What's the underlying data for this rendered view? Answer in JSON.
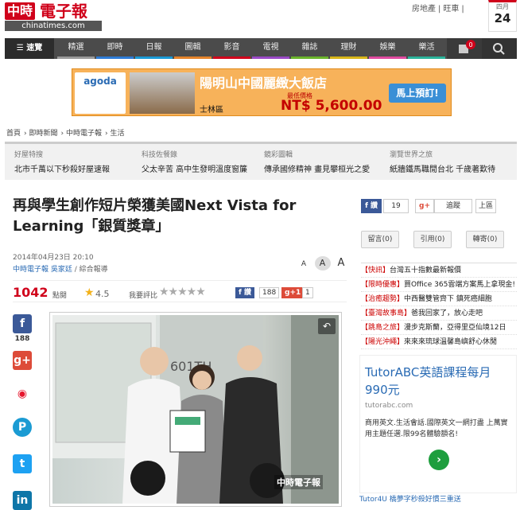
{
  "site": {
    "logo_zh": "中時",
    "logo_zh2": "電子報",
    "logo_en": "chinatimes.com",
    "links": [
      "房地產",
      "旺車"
    ],
    "date_month": "四月",
    "date_day": "24"
  },
  "nav": {
    "search_btn": "速覽",
    "items": [
      "精選",
      "即時",
      "日報",
      "圖輯",
      "影音",
      "電視",
      "雜誌",
      "理財",
      "娛樂",
      "樂活"
    ],
    "colors": [
      "#9a9a9a",
      "#2e7bd6",
      "#1a9ad6",
      "#e4832a",
      "#d0021b",
      "#9a49c6",
      "#6ab42a",
      "#d8b618",
      "#e04aa0",
      "#2ab39a"
    ],
    "bag_count": "0"
  },
  "ad": {
    "brand": "agoda",
    "hotel": "陽明山中國麗緻大飯店",
    "location": "士林區",
    "price_label": "最低價格",
    "price": "NT$ 5,600.00",
    "button": "馬上預訂!"
  },
  "breadcrumb": [
    "首頁",
    "即時新聞",
    "中時電子報",
    "生活"
  ],
  "strip": [
    {
      "head": "好屋特搜",
      "body": "北市千萬以下秒殺好屋速報"
    },
    {
      "head": "科技佐餐錄",
      "body": "父太辛苦 高中生發明溫度窗簾"
    },
    {
      "head": "鏡彩圖輯",
      "body": "傳承國修精神 畫見攀桓光之愛"
    },
    {
      "head": "瀏覽世界之旅",
      "body": "紙牆鐵馬職閒台北 千歲著歎待"
    }
  ],
  "article": {
    "title": "再與學生創作短片榮獲美國Next Vista for Learning「銀質獎章」",
    "datetime": "2014年04月23日 20:10",
    "source": "中時電子報",
    "author": "吳家廷",
    "source_suffix": "/ 綜合報導",
    "font_sizes": [
      "A",
      "A",
      "A"
    ],
    "views": "1042",
    "views_label": "點閱",
    "rating": "4.5",
    "rate_label": "我要評比",
    "fb_label": "f 讚",
    "fb_count": "188",
    "gplus_label": "g+1",
    "gplus_count": "1",
    "watermark": "中時電子報",
    "photo_board_text": "601TH"
  },
  "social_bar": {
    "fb_count": "188"
  },
  "right": {
    "fb_label": "f 讚",
    "fb_count": "19",
    "gplus_label": "g+",
    "follow_label": "追蹤",
    "top_label": "上區",
    "tabs": [
      "留言(0)",
      "引用(0)",
      "轉寄(0)"
    ],
    "quick": [
      {
        "tag": "【快訊】",
        "text": "台灣五十指數最新報價"
      },
      {
        "tag": "【限時優惠】",
        "text": "買Office 365雲端方案馬上拿現金!"
      },
      {
        "tag": "【治癒趨勢】",
        "text": "中西醫雙管齊下 鎮死癌細胞"
      },
      {
        "tag": "【臺灣故事島】",
        "text": "爸我回家了，放心走吧"
      },
      {
        "tag": "【跳島之旅】",
        "text": "漫步克斯蘭，亞得里亞仙境12日"
      },
      {
        "tag": "【陽光沖繩】",
        "text": "來來來琉球溫馨島嶼舒心休閒"
      }
    ]
  },
  "ad2": {
    "headline": "TutorABC英語課程每月990元",
    "url": "tutorabc.com",
    "desc": "商用英文.生活會話.國際英文一網打盡 上萬實用主題任選.限99名體驗額名!",
    "footer": "Tutor4U 橋夢字秒殺好慣三重送"
  }
}
